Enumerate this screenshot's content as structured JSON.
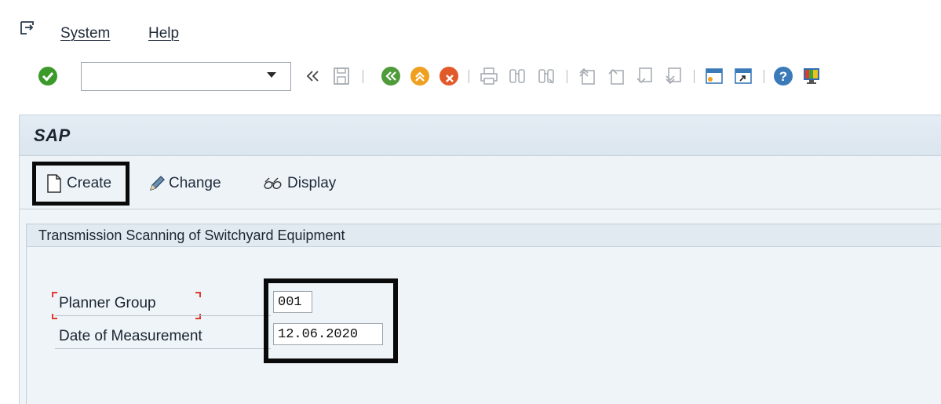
{
  "menu": {
    "items": [
      {
        "label": "System"
      },
      {
        "label": "Help"
      }
    ]
  },
  "toolbar": {
    "command_field_value": "",
    "icons": [
      "enter-icon",
      "back-double-icon",
      "save-icon",
      "back-icon",
      "exit-icon",
      "cancel-icon",
      "print-icon",
      "find-icon",
      "find-next-icon",
      "first-page-icon",
      "previous-page-icon",
      "next-page-icon",
      "last-page-icon",
      "create-session-icon",
      "shortcut-icon",
      "help-icon",
      "customize-layout-icon"
    ]
  },
  "app": {
    "title": "SAP",
    "buttons": [
      {
        "label": "Create",
        "icon": "document-icon"
      },
      {
        "label": "Change",
        "icon": "pencil-icon"
      },
      {
        "label": "Display",
        "icon": "glasses-icon"
      }
    ]
  },
  "group": {
    "title": "Transmission Scanning of Switchyard Equipment",
    "fields": [
      {
        "label": "Planner Group",
        "value": "001",
        "required": true
      },
      {
        "label": "Date of Measurement",
        "value": "12.06.2020",
        "required": false
      }
    ]
  },
  "colors": {
    "required_marker": "#e03a2e",
    "ok_green": "#3c9a2a",
    "highlight_box": "#0a0a0a",
    "frame_background": "#eff4f9"
  }
}
